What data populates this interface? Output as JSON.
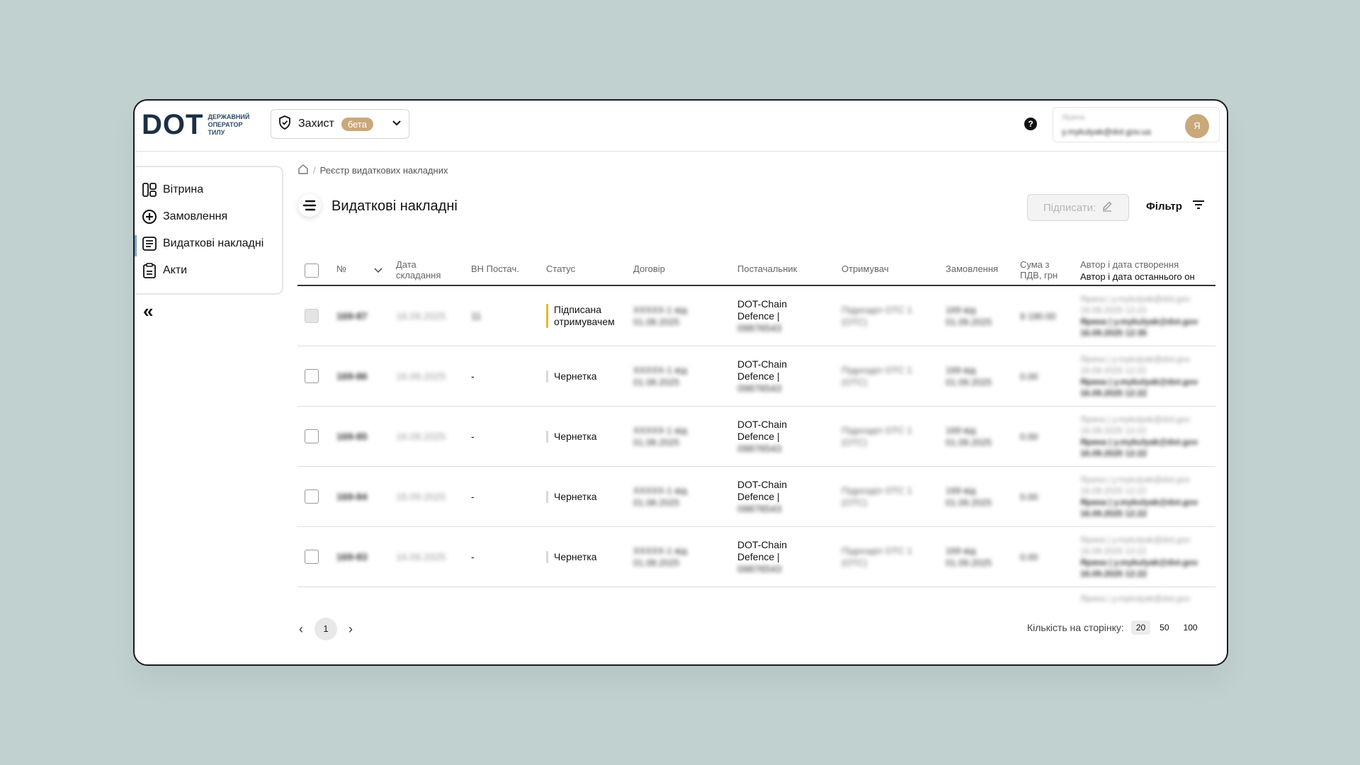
{
  "header": {
    "logo": "DOT",
    "logo_text": [
      "ДЕРЖАВНИЙ",
      "ОПЕРАТОР",
      "ТИЛУ"
    ],
    "module": "Захист",
    "module_badge": "бета",
    "help": "?",
    "user_name": "Ярина",
    "user_email": "y.mykulyak@dot.gov.ua",
    "avatar": "Я"
  },
  "sidebar": {
    "items": [
      {
        "label": "Вітрина",
        "icon": "grid-icon"
      },
      {
        "label": "Замовлення",
        "icon": "plus-circle-icon"
      },
      {
        "label": "Видаткові накладні",
        "icon": "document-icon"
      },
      {
        "label": "Акти",
        "icon": "clipboard-icon"
      }
    ],
    "collapse": "«"
  },
  "breadcrumb": {
    "current": "Реєстр видаткових накладних"
  },
  "page": {
    "title": "Видаткові накладні",
    "sign_button": "Підписати:",
    "filter_button": "Фільтр"
  },
  "table": {
    "columns": {
      "number": "№",
      "date": "Дата складання",
      "supplier_invoice": "ВН Постач.",
      "status": "Статус",
      "contract": "Договір",
      "supplier": "Постачальник",
      "recipient": "Отримувач",
      "order": "Замовлення",
      "sum": "Сума з ПДВ, грн",
      "author_created": "Автор і дата створення",
      "author_modified": "Автор і дата останнього он"
    },
    "rows": [
      {
        "number": "169-87",
        "date": "16.09.2025",
        "supplier_invoice": "11",
        "status": "Підписана отримувачем",
        "status_color": "#f0b429",
        "contract_1": "ХХХХХ-1 від",
        "contract_2": "01.08.2025",
        "supplier_1": "DOT-Chain",
        "supplier_2": "Defence |",
        "supplier_3": "09876543",
        "recipient_1": "Підрозділ ОТС 1",
        "recipient_2": "(ОТС)",
        "order_1": "169 від",
        "order_2": "01.09.2025",
        "sum": "9 190.00",
        "author_1": "Ярина | y.mykulyak@dot.gov",
        "author_2": "16.09.2025 12:23",
        "author_3": "Ярина | y.mykulyak@dot.gov",
        "author_4": "16.09.2025 12:35",
        "disabled": true
      },
      {
        "number": "169-86",
        "date": "16.09.2025",
        "supplier_invoice": "-",
        "status": "Чернетка",
        "status_color": "#d8d8d8",
        "contract_1": "ХХХХХ-1 від",
        "contract_2": "01.08.2025",
        "supplier_1": "DOT-Chain",
        "supplier_2": "Defence |",
        "supplier_3": "09876543",
        "recipient_1": "Підрозділ ОТС 1",
        "recipient_2": "(ОТС)",
        "order_1": "169 від",
        "order_2": "01.09.2025",
        "sum": "0.00",
        "author_1": "Ярина | y.mykulyak@dot.gov",
        "author_2": "16.09.2025 12:22",
        "author_3": "Ярина | y.mykulyak@dot.gov",
        "author_4": "16.09.2025 12:22",
        "disabled": false
      },
      {
        "number": "169-85",
        "date": "16.09.2025",
        "supplier_invoice": "-",
        "status": "Чернетка",
        "status_color": "#d8d8d8",
        "contract_1": "ХХХХХ-1 від",
        "contract_2": "01.08.2025",
        "supplier_1": "DOT-Chain",
        "supplier_2": "Defence |",
        "supplier_3": "09876543",
        "recipient_1": "Підрозділ ОТС 1",
        "recipient_2": "(ОТС)",
        "order_1": "169 від",
        "order_2": "01.09.2025",
        "sum": "0.00",
        "author_1": "Ярина | y.mykulyak@dot.gov",
        "author_2": "16.09.2025 12:22",
        "author_3": "Ярина | y.mykulyak@dot.gov",
        "author_4": "16.09.2025 12:22",
        "disabled": false
      },
      {
        "number": "169-84",
        "date": "16.09.2025",
        "supplier_invoice": "-",
        "status": "Чернетка",
        "status_color": "#d8d8d8",
        "contract_1": "ХХХХХ-1 від",
        "contract_2": "01.08.2025",
        "supplier_1": "DOT-Chain",
        "supplier_2": "Defence |",
        "supplier_3": "09876543",
        "recipient_1": "Підрозділ ОТС 1",
        "recipient_2": "(ОТС)",
        "order_1": "169 від",
        "order_2": "01.09.2025",
        "sum": "0.00",
        "author_1": "Ярина | y.mykulyak@dot.gov",
        "author_2": "16.09.2025 12:22",
        "author_3": "Ярина | y.mykulyak@dot.gov",
        "author_4": "16.09.2025 12:22",
        "disabled": false
      },
      {
        "number": "169-83",
        "date": "16.09.2025",
        "supplier_invoice": "-",
        "status": "Чернетка",
        "status_color": "#d8d8d8",
        "contract_1": "ХХХХХ-1 від",
        "contract_2": "01.08.2025",
        "supplier_1": "DOT-Chain",
        "supplier_2": "Defence |",
        "supplier_3": "09876543",
        "recipient_1": "Підрозділ ОТС 1",
        "recipient_2": "(ОТС)",
        "order_1": "169 від",
        "order_2": "01.09.2025",
        "sum": "0.00",
        "author_1": "Ярина | y.mykulyak@dot.gov",
        "author_2": "16.09.2025 12:22",
        "author_3": "Ярина | y.mykulyak@dot.gov",
        "author_4": "16.09.2025 12:22",
        "disabled": false
      }
    ],
    "trailing_author": "Ярина | y.mykulyak@dot.gov"
  },
  "pagination": {
    "current_page": "1",
    "per_page_label": "Кількість на сторінку:",
    "per_page_options": [
      "20",
      "50",
      "100"
    ],
    "per_page_selected": "20"
  },
  "colors": {
    "accent": "#c9a87a",
    "status_signed": "#f0b429",
    "active_nav": "#7da5c6"
  }
}
